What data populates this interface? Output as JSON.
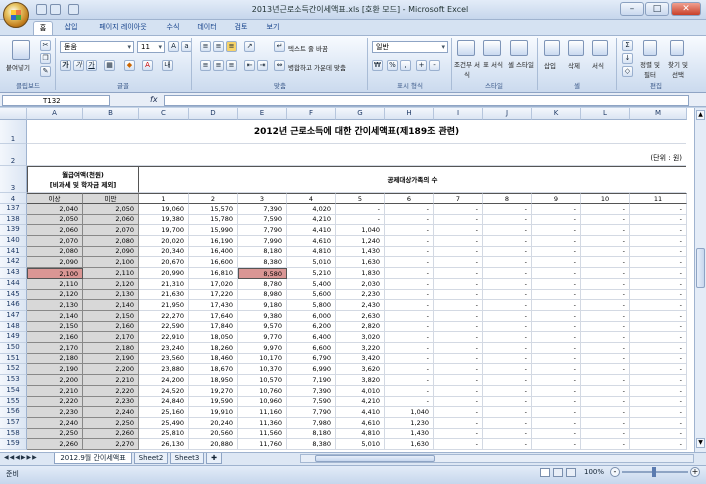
{
  "window": {
    "title": "2013년근로소득간이세액표.xls [호환 모드] - Microsoft Excel"
  },
  "tabs": [
    "홈",
    "삽입",
    "페이지 레이아웃",
    "수식",
    "데이터",
    "검토",
    "보기"
  ],
  "ribbon": {
    "paste": "붙여넣기",
    "clipboard": "클립보드",
    "font_name": "돋움",
    "font_size": "11",
    "font_group": "글꼴",
    "wrap_text": "텍스트 줄 바꿈",
    "merge_center": "병합하고 가운데 맞춤",
    "align_group": "맞춤",
    "number_format": "일반",
    "number_group": "표시 형식",
    "cond_format": "조건부 서식",
    "table_format": "표 서식",
    "cell_style": "셀 스타일",
    "style_group": "스타일",
    "insert": "삽입",
    "delete": "삭제",
    "format": "서식",
    "cells_group": "셀",
    "sort_filter": "정렬 및 필터",
    "find_select": "찾기 및 선택",
    "edit_group": "편집"
  },
  "formula": {
    "cell_ref": "T132",
    "fx": "fx",
    "value": ""
  },
  "columns": [
    "A",
    "B",
    "C",
    "D",
    "E",
    "F",
    "G",
    "H",
    "I",
    "J",
    "K",
    "L",
    "M"
  ],
  "sheet": {
    "title": "2012년 근로소득에 대한 간이세액표(제189조 관련)",
    "unit": "(단위 : 원)",
    "salary_header_1": "월급여액(천원)",
    "salary_header_2": "[비과세 및 학자금 제외]",
    "dependents_header": "공제대상가족의 수",
    "sub_headers": [
      "이상",
      "미만",
      "1",
      "2",
      "3",
      "4",
      "5",
      "6",
      "7",
      "8",
      "9",
      "10",
      "11"
    ]
  },
  "header_rows": [
    "1",
    "2",
    "3",
    "4"
  ],
  "rows": [
    {
      "n": "137",
      "c": [
        "2,040",
        "2,050",
        "19,060",
        "15,570",
        "7,390",
        "4,020",
        "-",
        "-",
        "-",
        "-",
        "-",
        "-",
        "-"
      ]
    },
    {
      "n": "138",
      "c": [
        "2,050",
        "2,060",
        "19,380",
        "15,780",
        "7,590",
        "4,210",
        "-",
        "-",
        "-",
        "-",
        "-",
        "-",
        "-"
      ]
    },
    {
      "n": "139",
      "c": [
        "2,060",
        "2,070",
        "19,700",
        "15,990",
        "7,790",
        "4,410",
        "1,040",
        "-",
        "-",
        "-",
        "-",
        "-",
        "-"
      ]
    },
    {
      "n": "140",
      "c": [
        "2,070",
        "2,080",
        "20,020",
        "16,190",
        "7,990",
        "4,610",
        "1,240",
        "-",
        "-",
        "-",
        "-",
        "-",
        "-"
      ]
    },
    {
      "n": "141",
      "c": [
        "2,080",
        "2,090",
        "20,340",
        "16,400",
        "8,180",
        "4,810",
        "1,430",
        "-",
        "-",
        "-",
        "-",
        "-",
        "-"
      ]
    },
    {
      "n": "142",
      "c": [
        "2,090",
        "2,100",
        "20,670",
        "16,600",
        "8,380",
        "5,010",
        "1,630",
        "-",
        "-",
        "-",
        "-",
        "-",
        "-"
      ]
    },
    {
      "n": "143",
      "c": [
        "2,100",
        "2,110",
        "20,990",
        "16,810",
        "8,580",
        "5,210",
        "1,830",
        "-",
        "-",
        "-",
        "-",
        "-",
        "-"
      ],
      "hl": true
    },
    {
      "n": "144",
      "c": [
        "2,110",
        "2,120",
        "21,310",
        "17,020",
        "8,780",
        "5,400",
        "2,030",
        "-",
        "-",
        "-",
        "-",
        "-",
        "-"
      ]
    },
    {
      "n": "145",
      "c": [
        "2,120",
        "2,130",
        "21,630",
        "17,220",
        "8,980",
        "5,600",
        "2,230",
        "-",
        "-",
        "-",
        "-",
        "-",
        "-"
      ]
    },
    {
      "n": "146",
      "c": [
        "2,130",
        "2,140",
        "21,950",
        "17,430",
        "9,180",
        "5,800",
        "2,430",
        "-",
        "-",
        "-",
        "-",
        "-",
        "-"
      ]
    },
    {
      "n": "147",
      "c": [
        "2,140",
        "2,150",
        "22,270",
        "17,640",
        "9,380",
        "6,000",
        "2,630",
        "-",
        "-",
        "-",
        "-",
        "-",
        "-"
      ]
    },
    {
      "n": "148",
      "c": [
        "2,150",
        "2,160",
        "22,590",
        "17,840",
        "9,570",
        "6,200",
        "2,820",
        "-",
        "-",
        "-",
        "-",
        "-",
        "-"
      ]
    },
    {
      "n": "149",
      "c": [
        "2,160",
        "2,170",
        "22,910",
        "18,050",
        "9,770",
        "6,400",
        "3,020",
        "-",
        "-",
        "-",
        "-",
        "-",
        "-"
      ]
    },
    {
      "n": "150",
      "c": [
        "2,170",
        "2,180",
        "23,240",
        "18,260",
        "9,970",
        "6,600",
        "3,220",
        "-",
        "-",
        "-",
        "-",
        "-",
        "-"
      ]
    },
    {
      "n": "151",
      "c": [
        "2,180",
        "2,190",
        "23,560",
        "18,460",
        "10,170",
        "6,790",
        "3,420",
        "-",
        "-",
        "-",
        "-",
        "-",
        "-"
      ]
    },
    {
      "n": "152",
      "c": [
        "2,190",
        "2,200",
        "23,880",
        "18,670",
        "10,370",
        "6,990",
        "3,620",
        "-",
        "-",
        "-",
        "-",
        "-",
        "-"
      ]
    },
    {
      "n": "153",
      "c": [
        "2,200",
        "2,210",
        "24,200",
        "18,950",
        "10,570",
        "7,190",
        "3,820",
        "-",
        "-",
        "-",
        "-",
        "-",
        "-"
      ]
    },
    {
      "n": "154",
      "c": [
        "2,210",
        "2,220",
        "24,520",
        "19,270",
        "10,760",
        "7,390",
        "4,010",
        "-",
        "-",
        "-",
        "-",
        "-",
        "-"
      ]
    },
    {
      "n": "155",
      "c": [
        "2,220",
        "2,230",
        "24,840",
        "19,590",
        "10,960",
        "7,590",
        "4,210",
        "-",
        "-",
        "-",
        "-",
        "-",
        "-"
      ]
    },
    {
      "n": "156",
      "c": [
        "2,230",
        "2,240",
        "25,160",
        "19,910",
        "11,160",
        "7,790",
        "4,410",
        "1,040",
        "-",
        "-",
        "-",
        "-",
        "-"
      ]
    },
    {
      "n": "157",
      "c": [
        "2,240",
        "2,250",
        "25,490",
        "20,240",
        "11,360",
        "7,980",
        "4,610",
        "1,230",
        "-",
        "-",
        "-",
        "-",
        "-"
      ]
    },
    {
      "n": "158",
      "c": [
        "2,250",
        "2,260",
        "25,810",
        "20,560",
        "11,560",
        "8,180",
        "4,810",
        "1,430",
        "-",
        "-",
        "-",
        "-",
        "-"
      ]
    },
    {
      "n": "159",
      "c": [
        "2,260",
        "2,270",
        "26,130",
        "20,880",
        "11,760",
        "8,380",
        "5,010",
        "1,630",
        "-",
        "-",
        "-",
        "-",
        "-"
      ]
    }
  ],
  "sheet_tabs": [
    "2012.9월 간이세액표",
    "Sheet2",
    "Sheet3"
  ],
  "status": {
    "mode": "준비",
    "zoom": "100%"
  }
}
